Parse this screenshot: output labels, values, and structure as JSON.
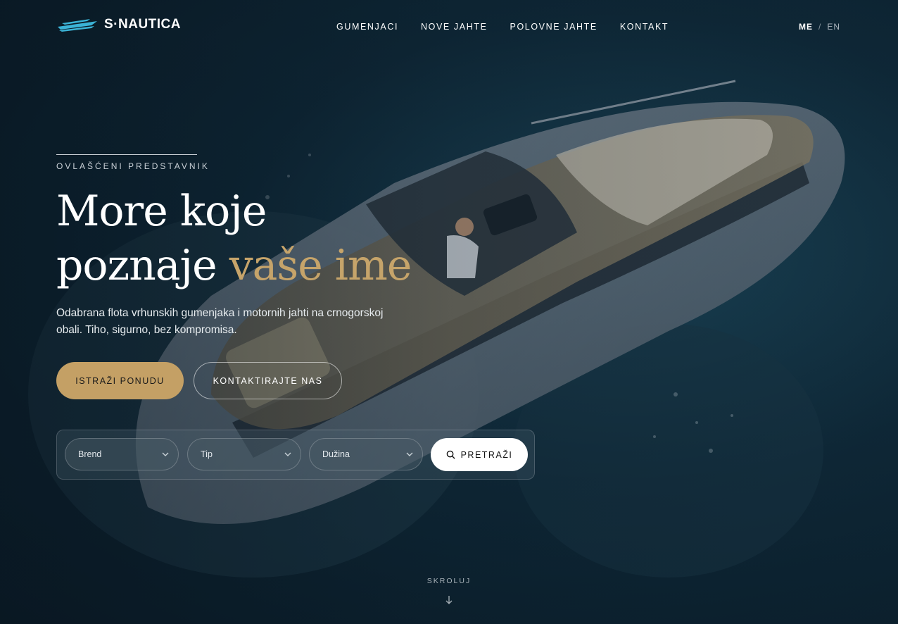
{
  "brand": {
    "name": "S·NAUTICA"
  },
  "nav": {
    "items": [
      {
        "label": "GUMENJACI"
      },
      {
        "label": "NOVE JAHTE"
      },
      {
        "label": "POLOVNE JAHTE"
      },
      {
        "label": "KONTAKT"
      }
    ]
  },
  "lang": {
    "active": "ME",
    "separator": "/",
    "other": "EN"
  },
  "hero": {
    "eyebrow": "OVLAŠĆENI PREDSTAVNIK",
    "headline_line1": "More koje",
    "headline_line2_start": "poznaje ",
    "headline_line2_accent": "vaše ime",
    "lede": "Odabrana flota vrhunskih gumenjaka i motornih jahti na crnogorskoj obali. Tiho, sigurno, bez kompromisa.",
    "primary_cta": "ISTRAŽI PONUDU",
    "secondary_cta": "KONTAKTIRAJTE NAS"
  },
  "search": {
    "brand_label": "Brend",
    "type_label": "Tip",
    "length_label": "Dužina",
    "submit_label": "PRETRAŽI"
  },
  "scroll": {
    "label": "SKROLUJ"
  },
  "colors": {
    "accent_gold": "#c6a46a",
    "button_gold": "#c4a065",
    "logo_cyan": "#3bb3d6"
  },
  "icons": {
    "logo": "boat-logo-icon",
    "dropdown": "chevron-down-icon",
    "search": "search-icon",
    "scroll": "arrow-down-icon"
  }
}
